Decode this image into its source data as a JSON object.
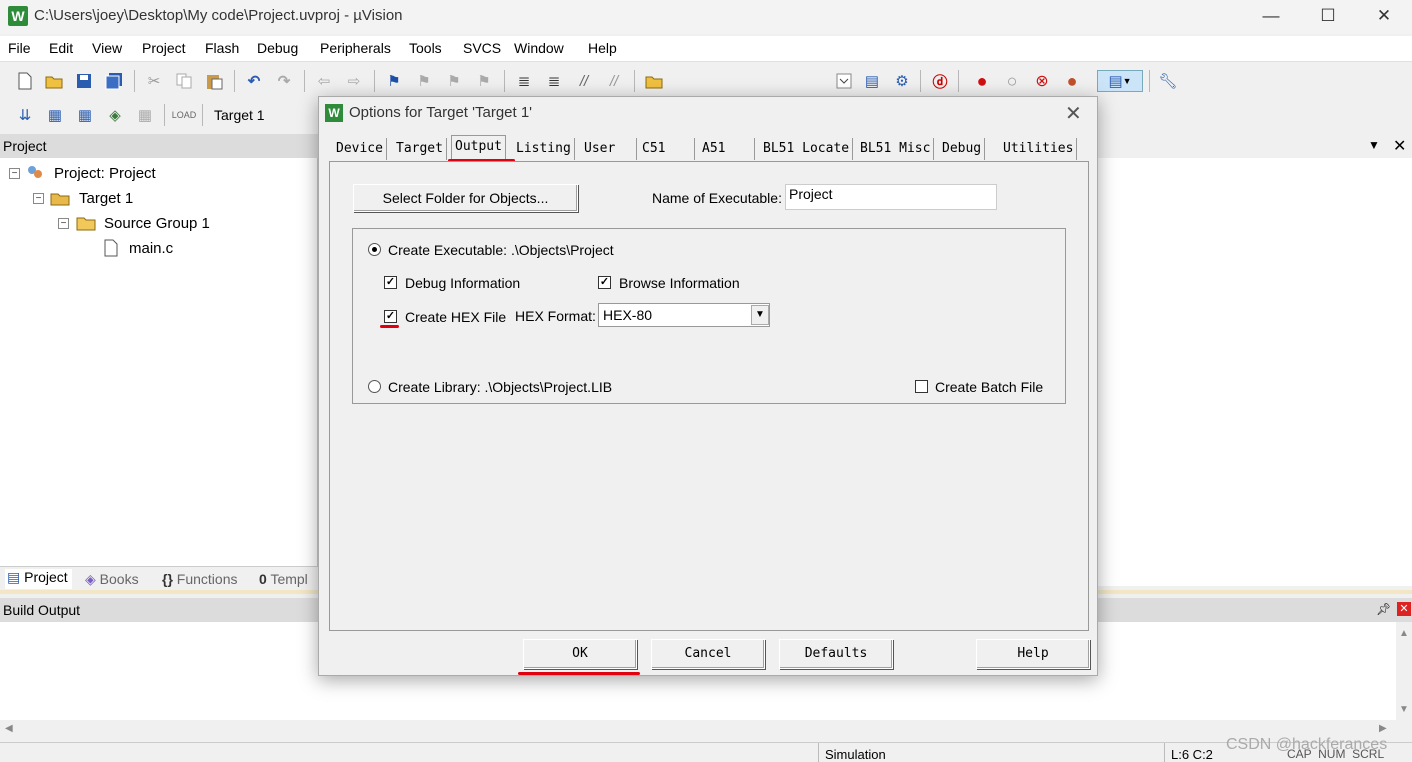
{
  "window": {
    "title": "C:\\Users\\joey\\Desktop\\My code\\Project.uvproj - µVision",
    "logo": "W",
    "minimize": "—",
    "maximize": "☐",
    "close": "✕"
  },
  "menu": [
    "File",
    "Edit",
    "View",
    "Project",
    "Flash",
    "Debug",
    "Peripherals",
    "Tools",
    "SVCS",
    "Window",
    "Help"
  ],
  "toolbar2": {
    "target": "Target 1"
  },
  "project_panel": {
    "title": "Project",
    "tree": {
      "project": "Project: Project",
      "target": "Target 1",
      "group": "Source Group 1",
      "file": "main.c"
    },
    "tabs": [
      "Project",
      "Books",
      "Functions",
      "Templ"
    ]
  },
  "build_output": {
    "title": "Build Output"
  },
  "statusbar": {
    "mode": "Simulation",
    "position": "L:6 C:2",
    "flags": "CAP  NUM  SCRL"
  },
  "watermark": "CSDN @hackferances",
  "dialog": {
    "title": "Options for Target 'Target 1'",
    "tabs": [
      "Device",
      "Target",
      "Output",
      "Listing",
      "User",
      "C51",
      "A51",
      "BL51 Locate",
      "BL51 Misc",
      "Debug",
      "Utilities"
    ],
    "active_tab": "Output",
    "select_folder_button": "Select Folder for Objects...",
    "name_label": "Name of Executable:",
    "name_value": "Project",
    "create_executable": "Create Executable:  .\\Objects\\Project",
    "debug_info": "Debug Information",
    "browse_info": "Browse Information",
    "create_hex": "Create HEX File",
    "hex_format_label": "HEX Format:",
    "hex_format_value": "HEX-80",
    "create_library": "Create Library:  .\\Objects\\Project.LIB",
    "create_batch": "Create Batch File",
    "check": "✓",
    "buttons": {
      "ok": "OK",
      "cancel": "Cancel",
      "defaults": "Defaults",
      "help": "Help"
    }
  },
  "colors": {
    "highlight_red": "#e0000e",
    "logo_green": "#2e8b3a"
  }
}
